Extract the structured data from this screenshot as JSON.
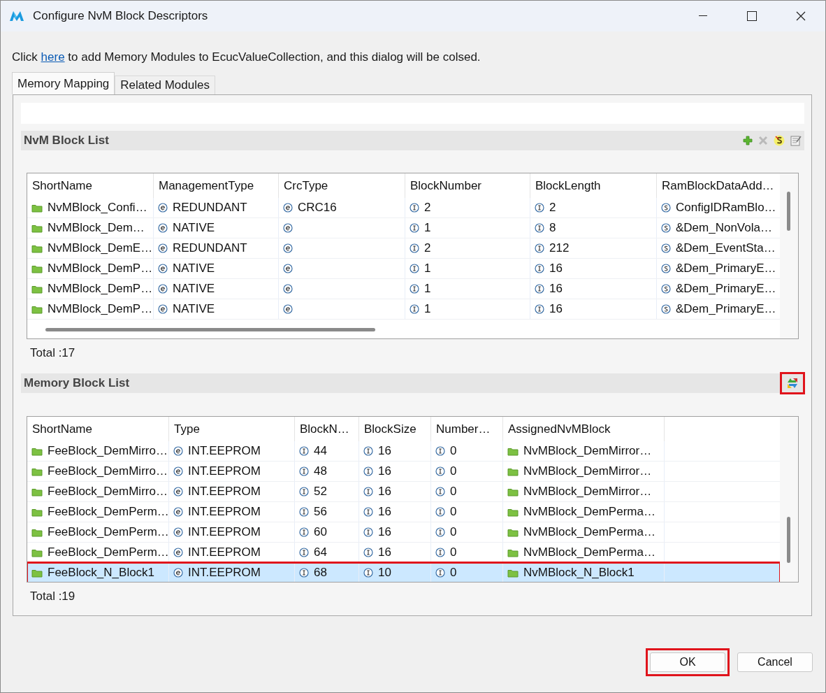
{
  "window": {
    "title": "Configure NvM Block Descriptors"
  },
  "message": {
    "before": "Click",
    "link": "here",
    "after": "to add Memory Modules to EcucValueCollection, and this dialog will be colsed."
  },
  "tabs": [
    {
      "label": "Memory Mapping",
      "selected": true
    },
    {
      "label": "Related Modules",
      "selected": false
    }
  ],
  "nvm_block_list": {
    "title": "NvM Block List",
    "toolbar": [
      {
        "kind": "add",
        "disabled": false
      },
      {
        "kind": "delete",
        "disabled": true
      },
      {
        "kind": "highlight",
        "disabled": false
      },
      {
        "kind": "edit",
        "disabled": false
      }
    ],
    "columns": [
      "ShortName",
      "ManagementType",
      "CrcType",
      "BlockNumber",
      "BlockLength",
      "RamBlockDataAdd…"
    ],
    "rows": [
      {
        "selected": false,
        "highlighted": false,
        "cells": [
          {
            "kind": "folder",
            "text": "NvMBlock_Confi…"
          },
          {
            "kind": "enum",
            "text": "REDUNDANT"
          },
          {
            "kind": "enum",
            "text": "CRC16"
          },
          {
            "kind": "int",
            "text": "2"
          },
          {
            "kind": "int",
            "text": "2"
          },
          {
            "kind": "string",
            "text": "ConfigIDRamBlo…"
          }
        ]
      },
      {
        "selected": false,
        "highlighted": false,
        "cells": [
          {
            "kind": "folder",
            "text": "NvMBlock_Dem…"
          },
          {
            "kind": "enum",
            "text": "NATIVE"
          },
          {
            "kind": "enum"
          },
          {
            "kind": "int",
            "text": "1"
          },
          {
            "kind": "int",
            "text": "8"
          },
          {
            "kind": "string",
            "text": "&Dem_NonVola…"
          }
        ]
      },
      {
        "selected": false,
        "highlighted": false,
        "cells": [
          {
            "kind": "folder",
            "text": "NvMBlock_DemE…"
          },
          {
            "kind": "enum",
            "text": "REDUNDANT"
          },
          {
            "kind": "enum"
          },
          {
            "kind": "int",
            "text": "2"
          },
          {
            "kind": "int",
            "text": "212"
          },
          {
            "kind": "string",
            "text": "&Dem_EventSta…"
          }
        ]
      },
      {
        "selected": false,
        "highlighted": false,
        "cells": [
          {
            "kind": "folder",
            "text": "NvMBlock_DemP…"
          },
          {
            "kind": "enum",
            "text": "NATIVE"
          },
          {
            "kind": "enum"
          },
          {
            "kind": "int",
            "text": "1"
          },
          {
            "kind": "int",
            "text": "16"
          },
          {
            "kind": "string",
            "text": "&Dem_PrimaryE…"
          }
        ]
      },
      {
        "selected": false,
        "highlighted": false,
        "cells": [
          {
            "kind": "folder",
            "text": "NvMBlock_DemP…"
          },
          {
            "kind": "enum",
            "text": "NATIVE"
          },
          {
            "kind": "enum"
          },
          {
            "kind": "int",
            "text": "1"
          },
          {
            "kind": "int",
            "text": "16"
          },
          {
            "kind": "string",
            "text": "&Dem_PrimaryE…"
          }
        ]
      },
      {
        "selected": false,
        "highlighted": false,
        "cells": [
          {
            "kind": "folder",
            "text": "NvMBlock_DemP…"
          },
          {
            "kind": "enum",
            "text": "NATIVE"
          },
          {
            "kind": "enum"
          },
          {
            "kind": "int",
            "text": "1"
          },
          {
            "kind": "int",
            "text": "16"
          },
          {
            "kind": "string",
            "text": "&Dem_PrimaryE…"
          }
        ]
      }
    ],
    "total": "Total :17"
  },
  "memory_block_list": {
    "title": "Memory Block List",
    "refresh_highlighted": true,
    "columns": [
      "ShortName",
      "Type",
      "BlockN…",
      "BlockSize",
      "Number…",
      "AssignedNvMBlock"
    ],
    "rows": [
      {
        "selected": false,
        "highlighted": false,
        "cells": [
          {
            "kind": "folder",
            "text": "FeeBlock_DemMirro…"
          },
          {
            "kind": "enum",
            "text": "INT.EEPROM"
          },
          {
            "kind": "int",
            "text": "44"
          },
          {
            "kind": "int",
            "text": "16"
          },
          {
            "kind": "int",
            "text": "0"
          },
          {
            "kind": "folder",
            "text": "NvMBlock_DemMirror…"
          }
        ]
      },
      {
        "selected": false,
        "highlighted": false,
        "cells": [
          {
            "kind": "folder",
            "text": "FeeBlock_DemMirro…"
          },
          {
            "kind": "enum",
            "text": "INT.EEPROM"
          },
          {
            "kind": "int",
            "text": "48"
          },
          {
            "kind": "int",
            "text": "16"
          },
          {
            "kind": "int",
            "text": "0"
          },
          {
            "kind": "folder",
            "text": "NvMBlock_DemMirror…"
          }
        ]
      },
      {
        "selected": false,
        "highlighted": false,
        "cells": [
          {
            "kind": "folder",
            "text": "FeeBlock_DemMirro…"
          },
          {
            "kind": "enum",
            "text": "INT.EEPROM"
          },
          {
            "kind": "int",
            "text": "52"
          },
          {
            "kind": "int",
            "text": "16"
          },
          {
            "kind": "int",
            "text": "0"
          },
          {
            "kind": "folder",
            "text": "NvMBlock_DemMirror…"
          }
        ]
      },
      {
        "selected": false,
        "highlighted": false,
        "cells": [
          {
            "kind": "folder",
            "text": "FeeBlock_DemPerm…"
          },
          {
            "kind": "enum",
            "text": "INT.EEPROM"
          },
          {
            "kind": "int",
            "text": "56"
          },
          {
            "kind": "int",
            "text": "16"
          },
          {
            "kind": "int",
            "text": "0"
          },
          {
            "kind": "folder",
            "text": "NvMBlock_DemPerma…"
          }
        ]
      },
      {
        "selected": false,
        "highlighted": false,
        "cells": [
          {
            "kind": "folder",
            "text": "FeeBlock_DemPerm…"
          },
          {
            "kind": "enum",
            "text": "INT.EEPROM"
          },
          {
            "kind": "int",
            "text": "60"
          },
          {
            "kind": "int",
            "text": "16"
          },
          {
            "kind": "int",
            "text": "0"
          },
          {
            "kind": "folder",
            "text": "NvMBlock_DemPerma…"
          }
        ]
      },
      {
        "selected": false,
        "highlighted": false,
        "cells": [
          {
            "kind": "folder",
            "text": "FeeBlock_DemPerm…"
          },
          {
            "kind": "enum",
            "text": "INT.EEPROM"
          },
          {
            "kind": "int",
            "text": "64"
          },
          {
            "kind": "int",
            "text": "16"
          },
          {
            "kind": "int",
            "text": "0"
          },
          {
            "kind": "folder",
            "text": "NvMBlock_DemPerma…"
          }
        ]
      },
      {
        "selected": true,
        "highlighted": true,
        "cells": [
          {
            "kind": "folder",
            "text": "FeeBlock_N_Block1"
          },
          {
            "kind": "enum",
            "text": "INT.EEPROM"
          },
          {
            "kind": "int",
            "text": "68"
          },
          {
            "kind": "int",
            "text": "10"
          },
          {
            "kind": "int",
            "text": "0"
          },
          {
            "kind": "folder",
            "text": "NvMBlock_N_Block1"
          }
        ]
      }
    ],
    "total": "Total :19"
  },
  "buttons": [
    {
      "label": "OK",
      "highlighted": true
    },
    {
      "label": "Cancel",
      "highlighted": false
    }
  ]
}
